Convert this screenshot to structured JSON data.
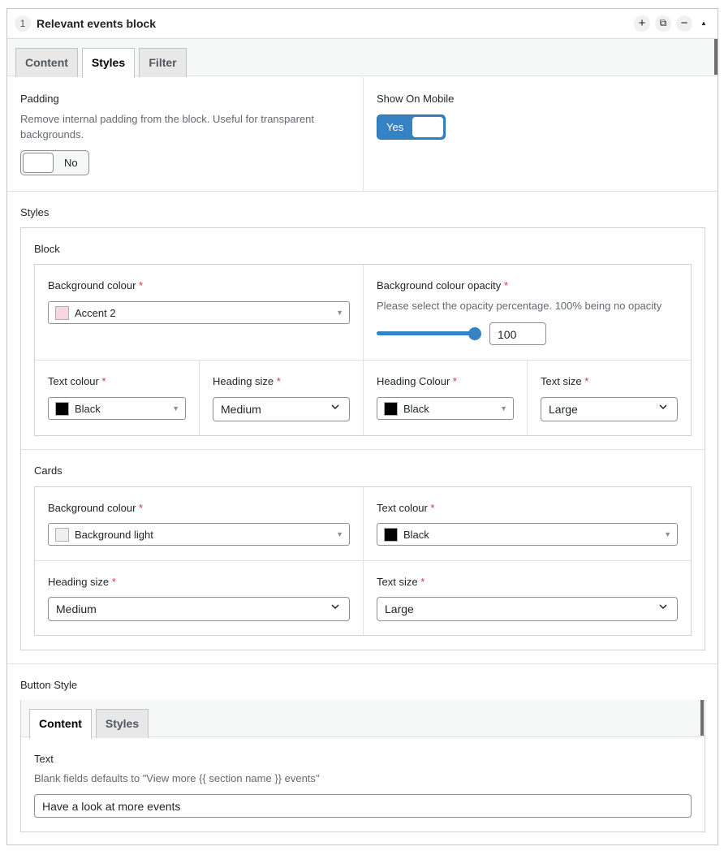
{
  "header": {
    "layout_number": "1",
    "title": "Relevant events block",
    "add_icon": "+",
    "duplicate_icon": "⧉",
    "remove_icon": "−",
    "collapse_icon": "▲"
  },
  "tabs": [
    {
      "label": "Content",
      "active": false
    },
    {
      "label": "Styles",
      "active": true
    },
    {
      "label": "Filter",
      "active": false
    }
  ],
  "padding": {
    "label": "Padding",
    "description_line1": "Remove internal padding from the block. Useful for transparent",
    "description_line2": "backgrounds.",
    "toggle_label": "No",
    "value": false
  },
  "show_on_mobile": {
    "label": "Show On Mobile",
    "toggle_label": "Yes",
    "value": true
  },
  "styles": {
    "label": "Styles",
    "block": {
      "label": "Block",
      "background_colour": {
        "label": "Background colour",
        "value": "Accent 2",
        "swatch": "#f8d7e0"
      },
      "background_opacity": {
        "label": "Background colour opacity",
        "description": "Please select the opacity percentage. 100% being no opacity",
        "value": "100",
        "percent": 100
      },
      "text_colour": {
        "label": "Text colour",
        "value": "Black",
        "swatch": "#000000"
      },
      "heading_size": {
        "label": "Heading size",
        "value": "Medium"
      },
      "heading_colour": {
        "label": "Heading Colour",
        "value": "Black",
        "swatch": "#000000"
      },
      "text_size": {
        "label": "Text size",
        "value": "Large"
      }
    },
    "cards": {
      "label": "Cards",
      "background_colour": {
        "label": "Background colour",
        "value": "Background light",
        "swatch": "#efefef"
      },
      "text_colour": {
        "label": "Text colour",
        "value": "Black",
        "swatch": "#000000"
      },
      "heading_size": {
        "label": "Heading size",
        "value": "Medium"
      },
      "text_size": {
        "label": "Text size",
        "value": "Large"
      }
    }
  },
  "button_style": {
    "label": "Button Style",
    "tabs": [
      {
        "label": "Content",
        "active": true
      },
      {
        "label": "Styles",
        "active": false
      }
    ],
    "text": {
      "label": "Text",
      "description": "Blank fields defaults to \"View more {{ section name }} events\"",
      "value": "Have a look at more events"
    }
  },
  "required_marker": "*",
  "colors": {
    "accent": "#3582c4",
    "required": "#d63638",
    "border": "#c3c4c7"
  }
}
